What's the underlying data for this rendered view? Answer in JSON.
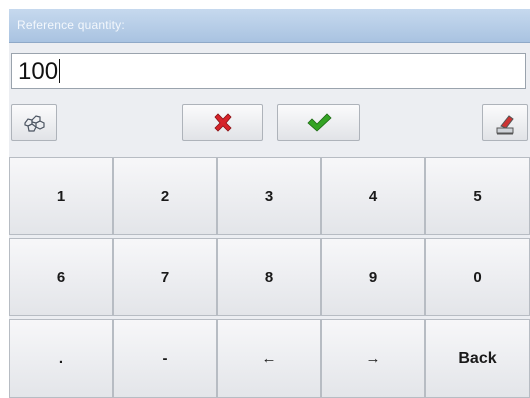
{
  "dialog": {
    "title": "Reference quantity:"
  },
  "input": {
    "value": "100"
  },
  "toolbar": {
    "left_icon": "molecule-icon",
    "cancel_icon": "red-x-icon",
    "ok_icon": "green-check-icon",
    "right_icon": "eraser-icon"
  },
  "keys": [
    "1",
    "2",
    "3",
    "4",
    "5",
    "6",
    "7",
    "8",
    "9",
    "0",
    ".",
    "-",
    "←",
    "→",
    "Back"
  ],
  "colors": {
    "title_bar": "#b7cde8",
    "cancel": "#d6232a",
    "ok": "#34a324",
    "key_bg": "#ececf0"
  }
}
